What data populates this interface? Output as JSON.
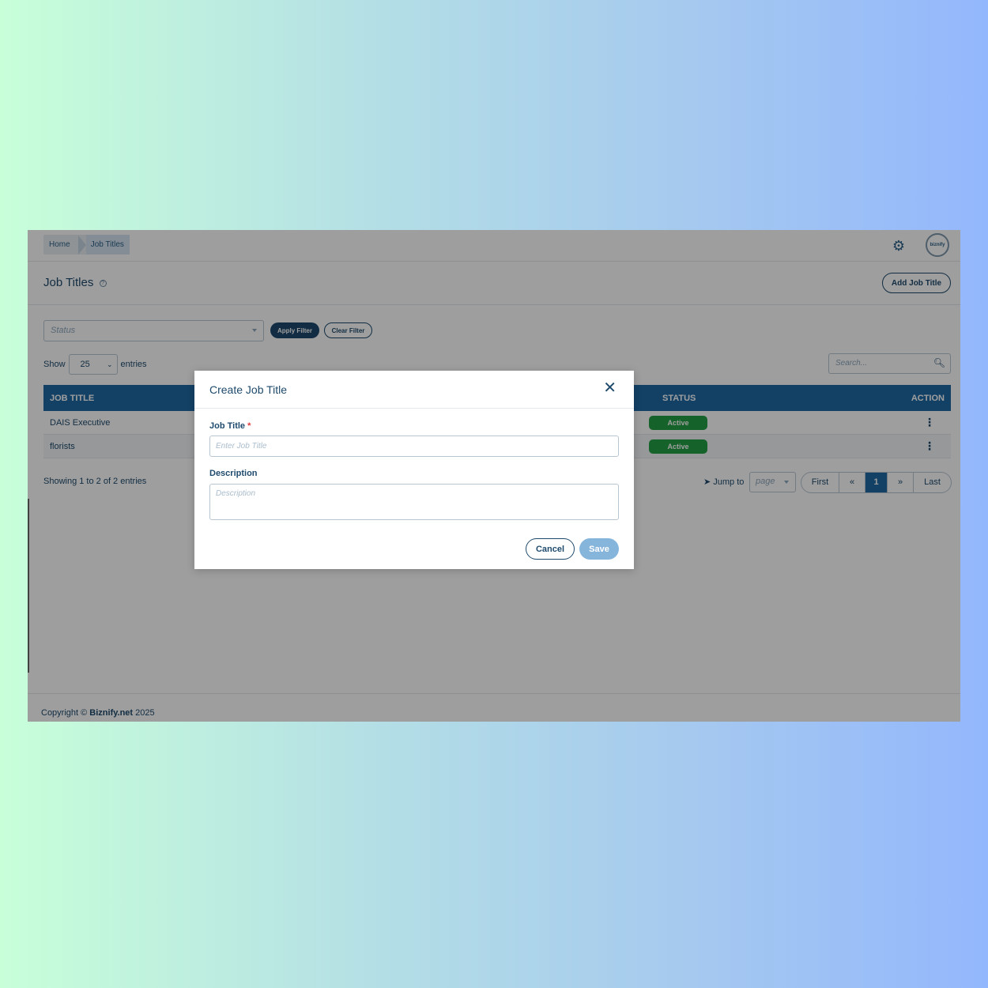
{
  "breadcrumb": {
    "home": "Home",
    "current": "Job Titles"
  },
  "header": {
    "avatar_text": "biznify",
    "title": "Job Titles",
    "help": "?",
    "add_button": "Add Job Title"
  },
  "filter": {
    "status_placeholder": "Status",
    "apply": "Apply Filter",
    "clear": "Clear Filter"
  },
  "entries": {
    "show": "Show",
    "value": "25",
    "suffix": "entries"
  },
  "search": {
    "placeholder": "Search..."
  },
  "table": {
    "columns": {
      "title": "JOB TITLE",
      "status": "STATUS",
      "action": "ACTION"
    },
    "rows": [
      {
        "title": "DAIS Executive",
        "status": "Active"
      },
      {
        "title": "florists",
        "status": "Active"
      }
    ]
  },
  "summary": "Showing 1 to 2 of 2 entries",
  "pagination": {
    "jump_label": "Jump to",
    "page_placeholder": "page",
    "first": "First",
    "prev": "«",
    "current": "1",
    "next": "»",
    "last": "Last"
  },
  "footer": {
    "prefix": "Copyright © ",
    "brand": "Biznify.net",
    "year": " 2025"
  },
  "modal": {
    "title": "Create Job Title",
    "job_title_label": "Job Title",
    "required_mark": "*",
    "job_title_placeholder": "Enter Job Title",
    "description_label": "Description",
    "description_placeholder": "Description",
    "cancel": "Cancel",
    "save": "Save"
  },
  "colors": {
    "primary": "#1f6aa5",
    "dark": "#1e4a6c",
    "active": "#22a144",
    "save_disabled": "#86b5dc"
  }
}
